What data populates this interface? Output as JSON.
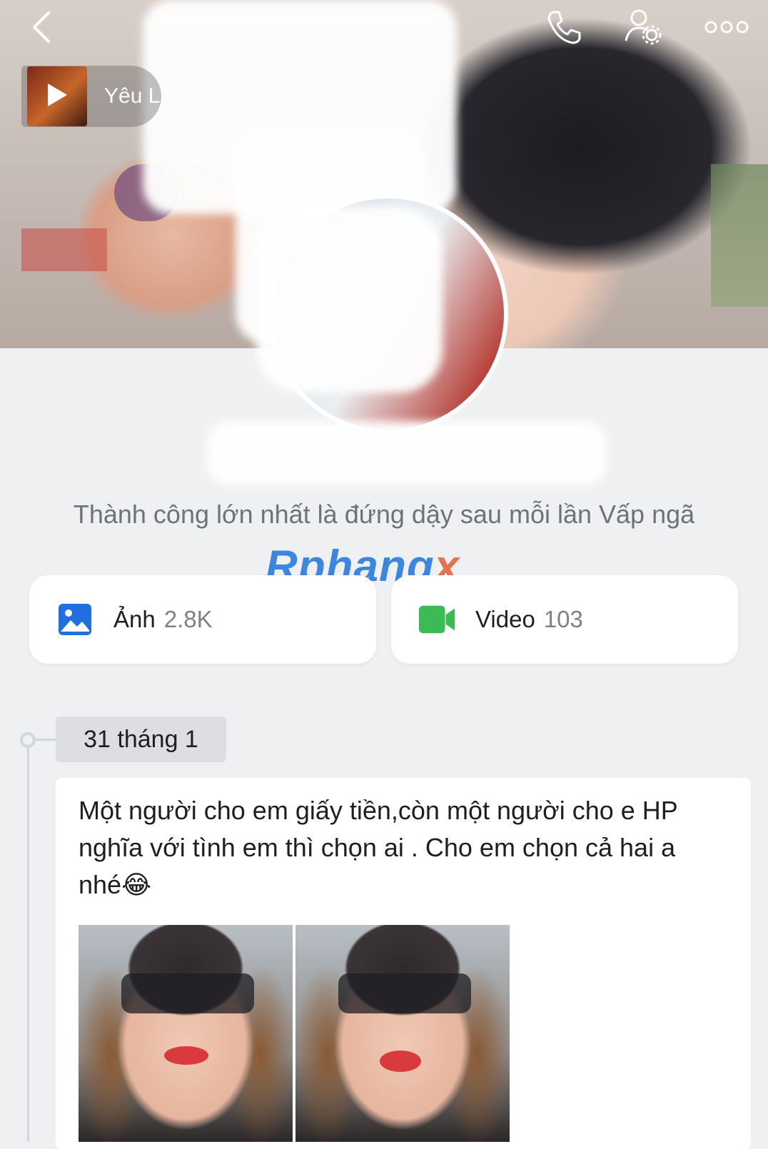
{
  "header": {
    "back_icon": "chevron-left-icon",
    "call_icon": "phone-icon",
    "profile_settings_icon": "user-gear-icon",
    "more_icon": "more-dots-icon"
  },
  "music": {
    "title": "Yêu L",
    "play_icon": "play-icon"
  },
  "profile": {
    "status": "Thành công lớn nhất là đứng dậy sau mỗi lần Vấp ngã"
  },
  "watermark": {
    "main": "Rphang",
    "accent": "x"
  },
  "media": {
    "photos": {
      "label": "Ảnh",
      "count": "2.8K",
      "icon": "image-icon",
      "color": "#1f6fe0"
    },
    "videos": {
      "label": "Video",
      "count": "103",
      "icon": "video-camera-icon",
      "color": "#3cba54"
    }
  },
  "timeline": {
    "date": "31 tháng 1",
    "post": {
      "text": "Một người cho em giấy tiền,còn một người cho e HP nghĩa với tình em thì chọn ai . Cho em chọn cả hai a nhé😂",
      "photos": [
        "photo-1",
        "photo-2"
      ]
    }
  }
}
